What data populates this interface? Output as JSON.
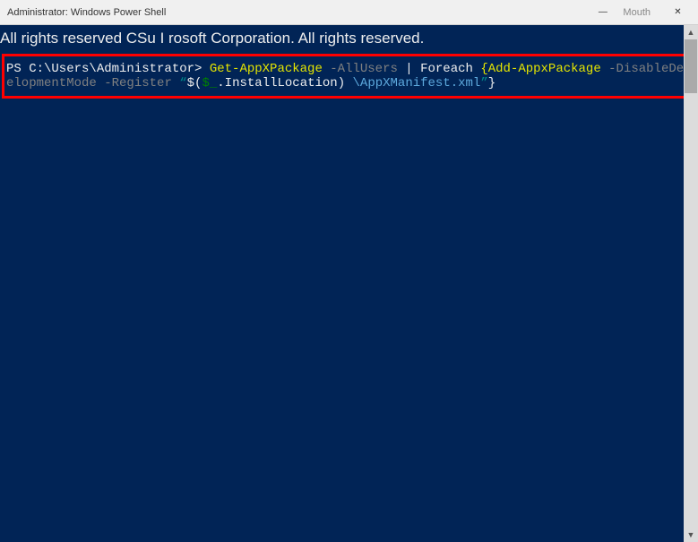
{
  "titlebar": {
    "title": "Administrator: Windows Power Shell",
    "mouth_label": "Mouth",
    "minimize_glyph": "—",
    "close_glyph": "✕"
  },
  "console": {
    "copyright": "All rights reserved CSu I rosoft Corporation. All rights reserved.",
    "prompt": "PS C:\\Users\\Administrator>",
    "cmd_getappx": " Get-AppXPackage ",
    "flag_allusers": "-AllUsers",
    "pipe_foreach": " | Foreach ",
    "brace_addappx": "{Add-AppxPackage ",
    "flag_disable": "-DisableDevelopmentMode",
    "flag_register": " -Register ",
    "quote_open": "“",
    "dollar_open": "$(",
    "var_underscore": "$_",
    "install_loc": ".InstallLocation)",
    "appx_manifest": " \\AppXManifest.xml",
    "quote_close": "”",
    "brace_close": "}"
  },
  "scrollbar": {
    "up": "▲",
    "down": "▼"
  }
}
